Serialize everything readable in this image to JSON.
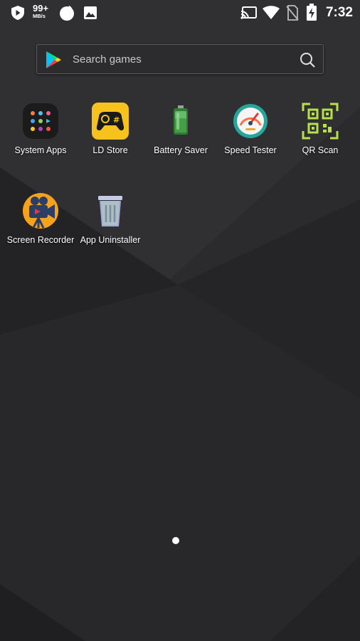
{
  "status_bar": {
    "net_speed_value": "99+",
    "net_speed_unit": "MB/s",
    "time": "7:32",
    "left_icons": [
      "shield-icon",
      "cloud-icon",
      "image-icon"
    ],
    "right_icons": [
      "cast-icon",
      "wifi-icon",
      "no-sim-icon",
      "battery-charging-icon"
    ]
  },
  "search": {
    "placeholder": "Search games",
    "icon_left": "play-store-icon",
    "icon_right": "search-icon"
  },
  "apps": [
    {
      "label": "System Apps",
      "icon": "system-apps-folder-icon"
    },
    {
      "label": "LD Store",
      "icon": "gamepad-icon"
    },
    {
      "label": "Battery Saver",
      "icon": "battery-icon"
    },
    {
      "label": "Speed Tester",
      "icon": "speedometer-icon"
    },
    {
      "label": "QR Scan",
      "icon": "qr-code-icon"
    },
    {
      "label": "Screen Recorder",
      "icon": "video-camera-icon"
    },
    {
      "label": "App Uninstaller",
      "icon": "trash-icon"
    }
  ],
  "page_indicator": {
    "pages": 1,
    "current": 1
  },
  "colors": {
    "ld_store_yellow": "#F7C21B",
    "qr_green": "#B8E04A"
  }
}
